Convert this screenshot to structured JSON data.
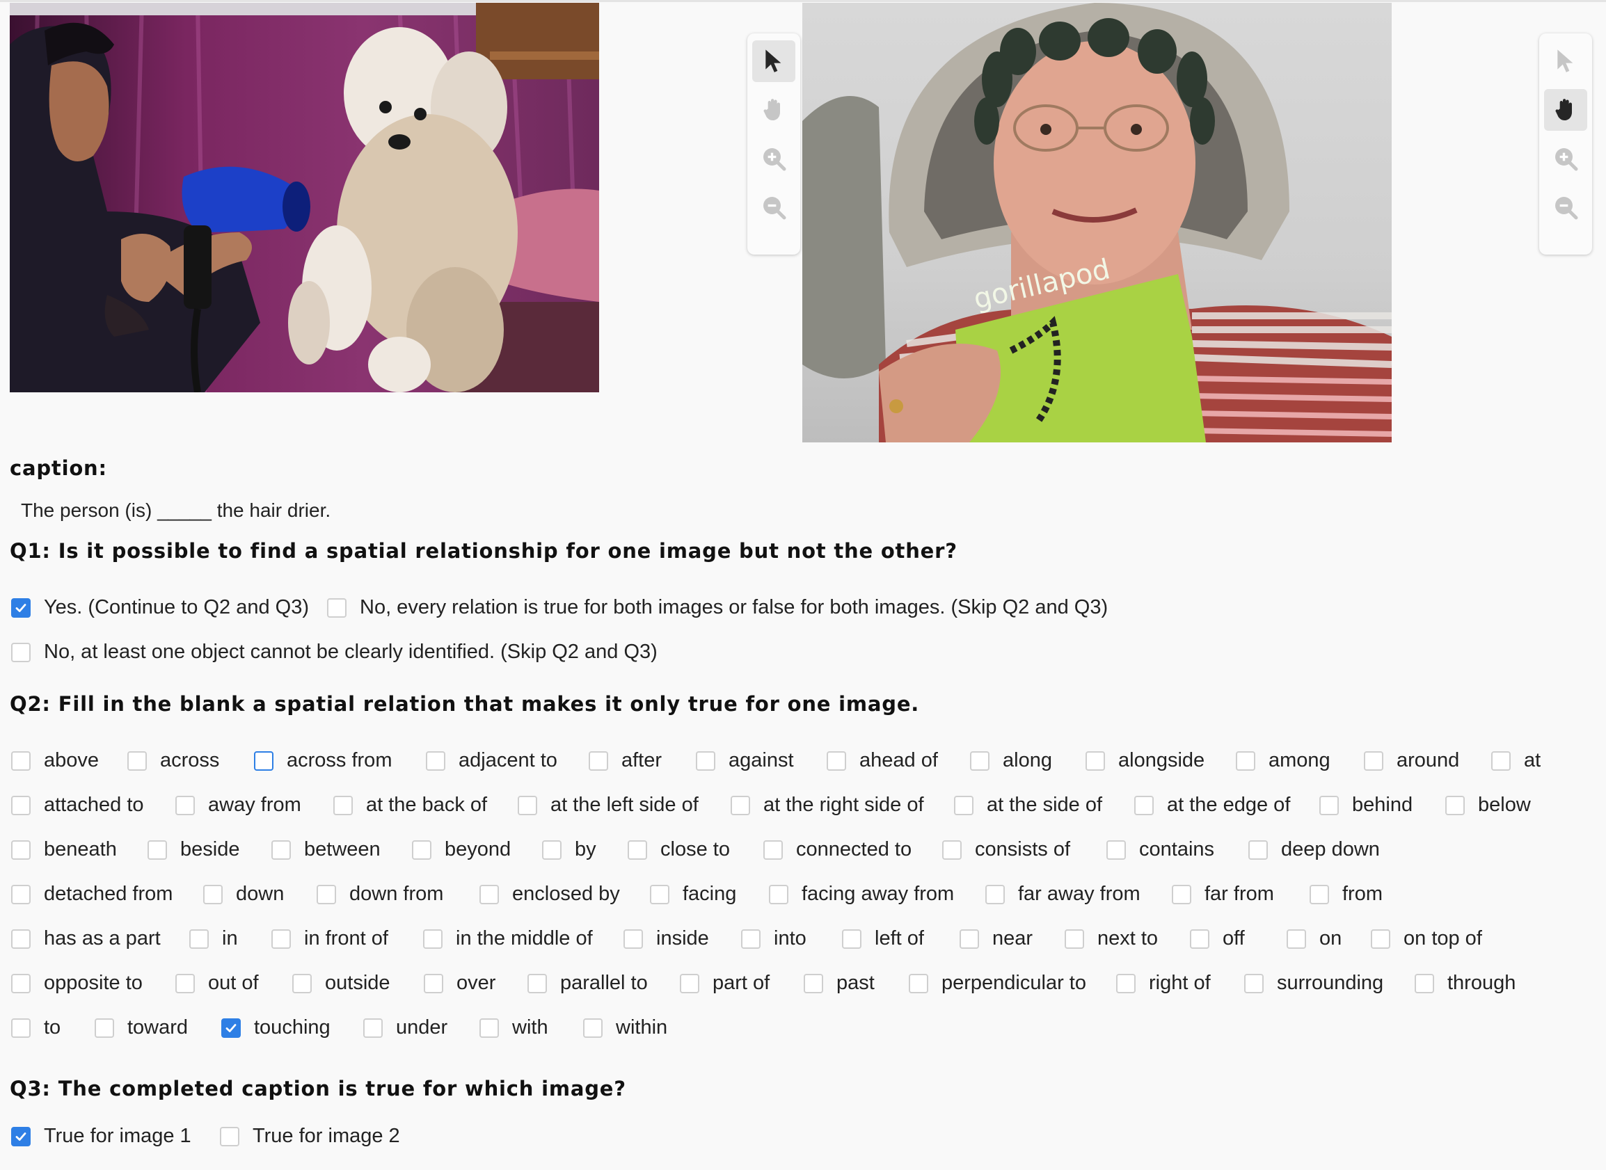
{
  "toolbar_images": [
    {
      "tools": [
        {
          "icon": "pointer-icon",
          "active": true
        },
        {
          "icon": "hand-icon",
          "active": false
        },
        {
          "icon": "zoom-in-icon",
          "active": false
        },
        {
          "icon": "zoom-out-icon",
          "active": false
        }
      ]
    },
    {
      "tools": [
        {
          "icon": "pointer-icon",
          "active": false
        },
        {
          "icon": "hand-icon",
          "active": true
        },
        {
          "icon": "zoom-in-icon",
          "active": false
        },
        {
          "icon": "zoom-out-icon",
          "active": false
        }
      ]
    }
  ],
  "photo_text": {
    "book_brand": "gorillapod"
  },
  "caption": {
    "label": "caption:",
    "text": "The person (is) _____ the hair drier."
  },
  "q1": {
    "title": "Q1: Is it possible to find a spatial relationship for one image but not the other?",
    "options": [
      {
        "label": "Yes. (Continue to Q2 and Q3)",
        "checked": true
      },
      {
        "label": "No, every relation is true for both images or false for both images. (Skip Q2 and Q3)",
        "checked": false
      },
      {
        "label": "No, at least one object cannot be clearly identified. (Skip Q2 and Q3)",
        "checked": false
      }
    ]
  },
  "q2": {
    "title": "Q2: Fill in the blank a spatial relation that makes it only true for one image.",
    "rows": [
      [
        "above",
        "across",
        "across from",
        "adjacent to",
        "after",
        "against",
        "ahead of",
        "along",
        "alongside",
        "among",
        "around",
        "at"
      ],
      [
        "attached to",
        "away from",
        "at the back of",
        "at the left side of",
        "at the right side of",
        "at the side of",
        "at the edge of",
        "behind",
        "below"
      ],
      [
        "beneath",
        "beside",
        "between",
        "beyond",
        "by",
        "close to",
        "connected to",
        "consists of",
        "contains",
        "deep down"
      ],
      [
        "detached from",
        "down",
        "down from",
        "enclosed by",
        "facing",
        "facing away from",
        "far away from",
        "far from",
        "from"
      ],
      [
        "has as a part",
        "in",
        "in front of",
        "in the middle of",
        "inside",
        "into",
        "left of",
        "near",
        "next to",
        "off",
        "on",
        "on top of"
      ],
      [
        "opposite to",
        "out of",
        "outside",
        "over",
        "parallel to",
        "part of",
        "past",
        "perpendicular to",
        "right of",
        "surrounding",
        "through"
      ],
      [
        "to",
        "toward",
        "touching",
        "under",
        "with",
        "within"
      ]
    ],
    "checked": [
      "touching"
    ],
    "focused": [
      "across from"
    ]
  },
  "q3": {
    "title": "Q3: The completed caption is true for which image?",
    "options": [
      {
        "label": "True for image 1",
        "checked": true
      },
      {
        "label": "True for image 2",
        "checked": false
      }
    ]
  },
  "colors": {
    "accent": "#2e7fe5",
    "checkbox_border": "#cfcfcf",
    "background": "#f9f9f9"
  }
}
